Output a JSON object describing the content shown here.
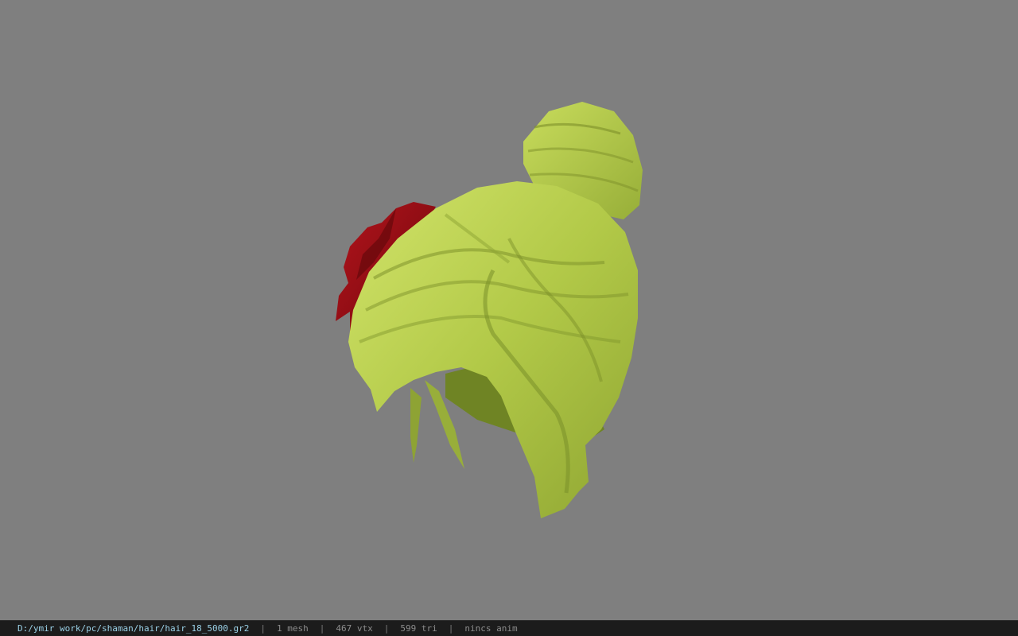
{
  "viewer": {
    "background_color": "#7f7f7f",
    "model": {
      "icon": "hair-model-icon",
      "hair_color": "#b7cf4a",
      "flower_color": "#8f0c12"
    }
  },
  "status_bar": {
    "file_path": "D:/ymir work/pc/shaman/hair/hair_18_5000.gr2",
    "mesh_count": "1 mesh",
    "vertex_count": "467 vtx",
    "triangle_count": "599 tri",
    "anim_status": "nincs anim",
    "separator": "|"
  }
}
